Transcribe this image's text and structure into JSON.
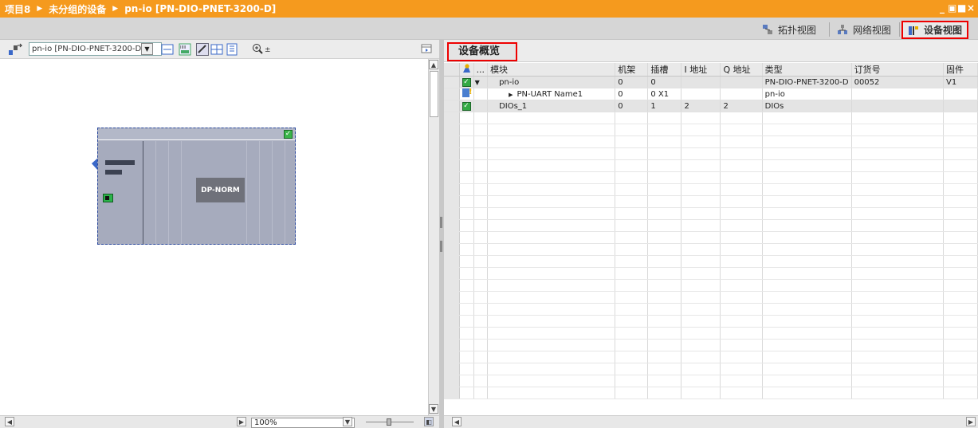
{
  "title_bar": {
    "crumbs": [
      "项目8",
      "未分组的设备",
      "pn-io [PN-DIO-PNET-3200-D]"
    ],
    "window_controls": [
      "_",
      "▣",
      "■",
      "×"
    ]
  },
  "view_tabs": {
    "topology": "拓扑视图",
    "network": "网络视图",
    "device": "设备视图"
  },
  "left_toolbar": {
    "device_selector": "pn-io [PN-DIO-PNET-3200-D]"
  },
  "canvas": {
    "device_tag": "pn-io",
    "module_label": "DP-NORM"
  },
  "left_bottom": {
    "zoom": "100%"
  },
  "overview": {
    "tab_label": "设备概览",
    "columns": {
      "gutter": "",
      "icon": "",
      "more": "...",
      "module": "模块",
      "rack": "机架",
      "slot": "插槽",
      "i_addr": "I 地址",
      "q_addr": "Q 地址",
      "type": "类型",
      "order": "订货号",
      "firmware": "固件"
    },
    "rows": [
      {
        "status": "ok",
        "expand": "▼",
        "module": "pn-io",
        "rack": "0",
        "slot": "0",
        "i_addr": "",
        "q_addr": "",
        "type": "PN-DIO-PNET-3200-D",
        "order": "00052",
        "firmware": "V1"
      },
      {
        "status": "warn",
        "expand": "▶",
        "module": "PN-UART Name1",
        "rack": "0",
        "slot": "0 X1",
        "i_addr": "",
        "q_addr": "",
        "type": "pn-io",
        "order": "",
        "firmware": ""
      },
      {
        "status": "ok",
        "expand": "",
        "module": "DIOs_1",
        "rack": "0",
        "slot": "1",
        "i_addr": "2",
        "q_addr": "2",
        "type": "DIOs",
        "order": "",
        "firmware": ""
      }
    ]
  },
  "colors": {
    "title_bar": "#f59a1e",
    "active_outline": "#e00000",
    "module_fill": "#a6abbd",
    "status_ok": "#33aa44"
  }
}
